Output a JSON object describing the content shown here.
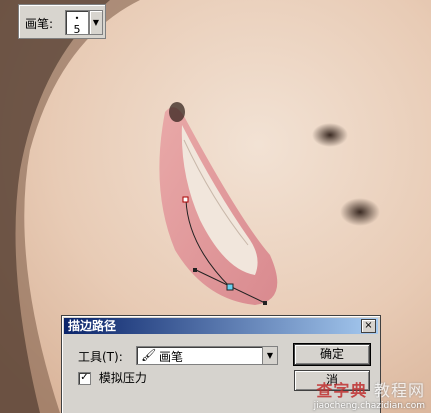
{
  "brush_bar": {
    "label": "画笔:",
    "size": "5"
  },
  "dialog": {
    "title": "描边路径",
    "close": "×",
    "tool_label": "工具(T):",
    "tool_value": "画笔",
    "simulate_pressure": "模拟压力",
    "ok": "确定",
    "cancel": "消"
  },
  "watermark": {
    "main": "查字典",
    "sub": "教程网",
    "url": "jiaocheng.chazidian.com"
  },
  "colors": {
    "titlebar_start": "#0a246a",
    "titlebar_end": "#a6caf0",
    "dialog_bg": "#d6d3ce"
  }
}
